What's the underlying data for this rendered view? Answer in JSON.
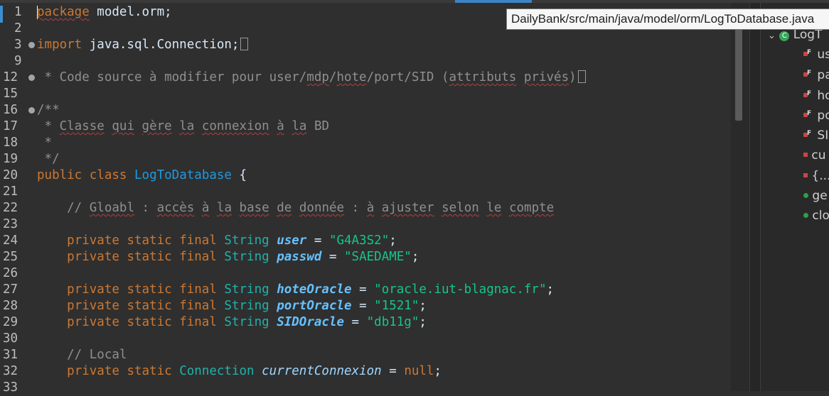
{
  "tooltip": {
    "path": "DailyBank/src/main/java/model/orm/LogToDatabase.java"
  },
  "outline": {
    "root": "LogT",
    "items": [
      {
        "label": "us",
        "icon": "static-final-field-icon"
      },
      {
        "label": "pa",
        "icon": "static-final-field-icon"
      },
      {
        "label": "ho",
        "icon": "static-final-field-icon"
      },
      {
        "label": "po",
        "icon": "static-final-field-icon"
      },
      {
        "label": "SI",
        "icon": "static-final-field-icon"
      },
      {
        "label": "cu",
        "icon": "private-static-field-icon"
      },
      {
        "label": "{...",
        "icon": "static-initializer-icon"
      },
      {
        "label": "ge",
        "icon": "public-static-method-icon"
      },
      {
        "label": "clo",
        "icon": "public-static-method-icon"
      }
    ]
  },
  "code": {
    "l1": {
      "n": "1",
      "kw": "package",
      "rest": " model.orm;"
    },
    "l2": {
      "n": "2"
    },
    "l3": {
      "n": "3",
      "kw": "import",
      "rest": " java.sql.Connection;"
    },
    "l9": {
      "n": "9"
    },
    "l12": {
      "n": "12",
      "a": " * Code source à modifier pour user/",
      "b": "mdp",
      "c": "/",
      "d": "hote",
      "e": "/port/SID (",
      "f": "attributs",
      "g": " ",
      "h": "privés",
      "i": ")"
    },
    "l15": {
      "n": "15"
    },
    "l16": {
      "n": "16",
      "text": "/**"
    },
    "l17": {
      "n": "17",
      "a": " * ",
      "b": "Classe",
      "c": " ",
      "d": "qui",
      "e": " ",
      "f": "gère",
      "g": " ",
      "h": "la",
      "i": " ",
      "j": "connexion",
      "k": " ",
      "l": "à",
      "m": " ",
      "n2": "la",
      "o": " BD"
    },
    "l18": {
      "n": "18",
      "text": " *"
    },
    "l19": {
      "n": "19",
      "text": " */"
    },
    "l20": {
      "n": "20",
      "kw1": "public",
      "kw2": "class",
      "cls": "LogToDatabase",
      "rest": " {"
    },
    "l21": {
      "n": "21"
    },
    "l22": {
      "n": "22",
      "a": "    // ",
      "b": "Gloabl",
      "c": " : ",
      "d": "accès",
      "e": " ",
      "f": "à",
      "g": " ",
      "h": "la",
      "i": " ",
      "j": "base",
      "k": " ",
      "l": "de",
      "m": " ",
      "n2": "donnée",
      "o": " : ",
      "p": "à",
      "q": " ",
      "r": "ajuster",
      "s": " ",
      "t": "selon",
      "u": " ",
      "v": "le",
      "w": " ",
      "x": "compte"
    },
    "l23": {
      "n": "23"
    },
    "mods": "private static final",
    "type": "String",
    "l24": {
      "n": "24",
      "field": "user",
      "val": "\"G4A3S2\""
    },
    "l25": {
      "n": "25",
      "field": "passwd",
      "val": "\"SAEDAME\""
    },
    "l26": {
      "n": "26"
    },
    "l27": {
      "n": "27",
      "field": "hoteOracle",
      "val": "\"oracle.iut-blagnac.fr\""
    },
    "l28": {
      "n": "28",
      "field": "portOracle",
      "val": "\"1521\""
    },
    "l29": {
      "n": "29",
      "field": "SIDOracle",
      "val": "\"db11g\""
    },
    "l30": {
      "n": "30"
    },
    "l31": {
      "n": "31",
      "text": "    // Local"
    },
    "l32": {
      "n": "32",
      "mods": "private static",
      "type": "Connection",
      "field": "currentConnexion",
      "val": "null"
    },
    "l33": {
      "n": "33"
    },
    "eq": " = ",
    "semi": ";"
  }
}
